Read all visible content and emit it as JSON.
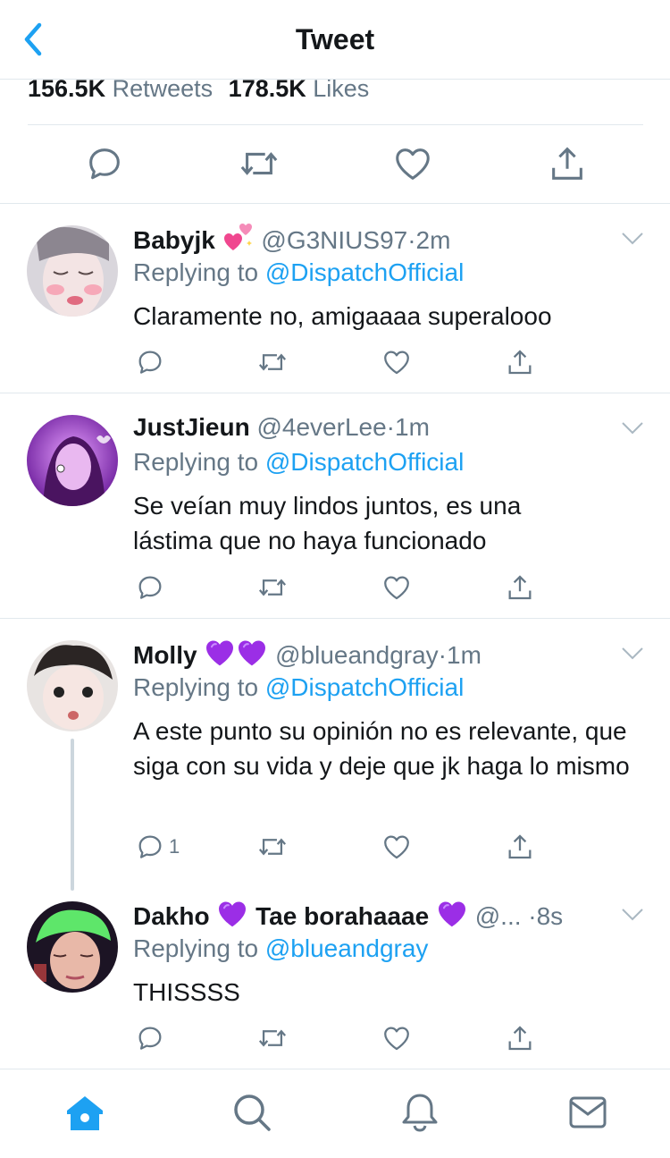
{
  "header": {
    "title": "Tweet",
    "back_icon": "chevron-left-icon"
  },
  "stats": {
    "retweets_count": "156.5K",
    "retweets_label": "Retweets",
    "likes_count": "178.5K",
    "likes_label": "Likes"
  },
  "main_actions": [
    "reply-icon",
    "retweet-icon",
    "like-icon",
    "share-icon"
  ],
  "replies": [
    {
      "name": "Babyjk",
      "name_emoji": "sparkling-hearts",
      "handle": "@G3NIUS97",
      "dot": "·",
      "time": "2m",
      "replying_prefix": "Replying to",
      "replying_to": "@DispatchOfficial",
      "text": "Claramente no, amigaaaa superalooo",
      "reply_count": ""
    },
    {
      "name": "JustJieun",
      "name_emoji": "",
      "handle": "@4everLee",
      "dot": "·",
      "time": "1m",
      "replying_prefix": "Replying to",
      "replying_to": "@DispatchOfficial",
      "text": "Se veían muy lindos juntos, es una lástima que no haya funcionado",
      "reply_count": ""
    },
    {
      "name": "Molly",
      "name_emoji": "purple-heart x2",
      "handle": "@blueandgray",
      "dot": "·",
      "time": "1m",
      "replying_prefix": "Replying to",
      "replying_to": "@DispatchOfficial",
      "text": "A este punto su opinión no es relevante, que siga con su vida y deje que jk haga lo mismo",
      "reply_count": "1"
    },
    {
      "name": "Dakho",
      "name_middle": "Tae borahaaae",
      "name_emoji": "purple-heart",
      "handle": "@...",
      "dot": "·",
      "time": "8s",
      "replying_prefix": "Replying to",
      "replying_to": "@blueandgray",
      "text": "THISSSS",
      "reply_count": ""
    }
  ],
  "tabs": [
    "home-icon",
    "search-icon",
    "notifications-icon",
    "messages-icon"
  ],
  "colors": {
    "accent": "#1da1f2",
    "secondary_text": "#657786",
    "divider": "#e1e8ed",
    "purple_heart": "#9b2ee6"
  }
}
